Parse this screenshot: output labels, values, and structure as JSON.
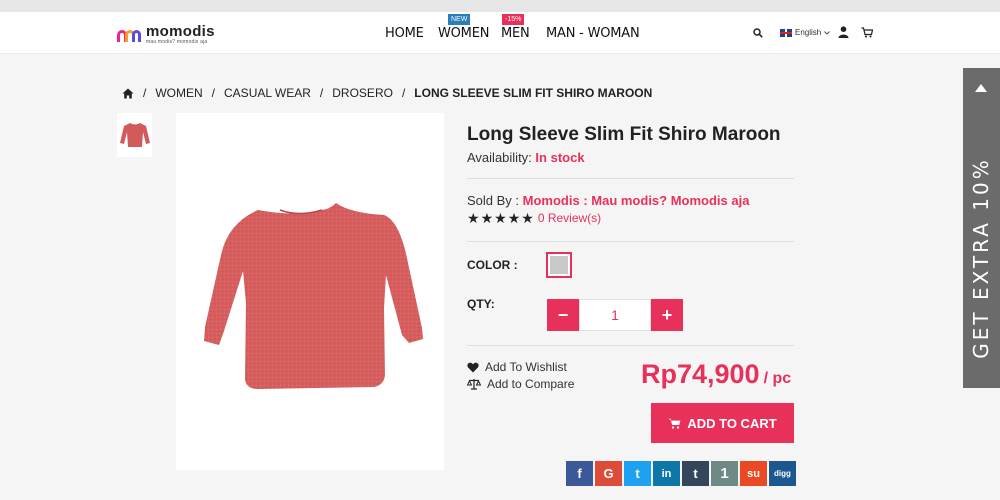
{
  "brand": {
    "name": "momodis",
    "tagline": "mau modis? momodis aja"
  },
  "nav": {
    "home": "HOME",
    "women": "WOMEN",
    "women_badge": "NEW",
    "men": "MEN",
    "men_badge": "-15%",
    "man_woman": "MAN - WOMAN"
  },
  "header": {
    "language": "English"
  },
  "breadcrumb": [
    "WOMEN",
    "CASUAL WEAR",
    "DROSERO",
    "LONG SLEEVE SLIM FIT SHIRO MAROON"
  ],
  "product": {
    "title": "Long Sleeve Slim Fit Shiro Maroon",
    "availability_label": "Availability:",
    "availability_value": "In stock",
    "sold_by_label": "Sold By :",
    "seller": "Momodis : Mau modis? Momodis aja",
    "rating_stars": 5,
    "reviews": "0 Review(s)",
    "color_label": "COLOR :",
    "selected_color": "#c9c9c9",
    "qty_label": "QTY:",
    "qty": "1",
    "qty_minus": "−",
    "qty_plus": "+",
    "wishlist": "Add To Wishlist",
    "compare": "Add to Compare",
    "price": "Rp74,900",
    "price_unit": "/ pc",
    "add_to_cart": "ADD TO CART"
  },
  "share": [
    {
      "name": "facebook",
      "glyph": "f",
      "color": "#3b5998"
    },
    {
      "name": "google-plus",
      "glyph": "G",
      "color": "#dd4b39"
    },
    {
      "name": "twitter",
      "glyph": "t",
      "color": "#1da1f2"
    },
    {
      "name": "linkedin",
      "glyph": "in",
      "color": "#0e76a8"
    },
    {
      "name": "tumblr",
      "glyph": "t",
      "color": "#35465c"
    },
    {
      "name": "one",
      "glyph": "1",
      "color": "#6f8a86"
    },
    {
      "name": "stumbleupon",
      "glyph": "su",
      "color": "#eb4924"
    },
    {
      "name": "digg",
      "glyph": "digg",
      "color": "#1b5891"
    }
  ],
  "promo": {
    "text": "GET EXTRA 10%"
  },
  "colors": {
    "accent": "#e8315a",
    "promo_bg": "#6b6b6b"
  }
}
